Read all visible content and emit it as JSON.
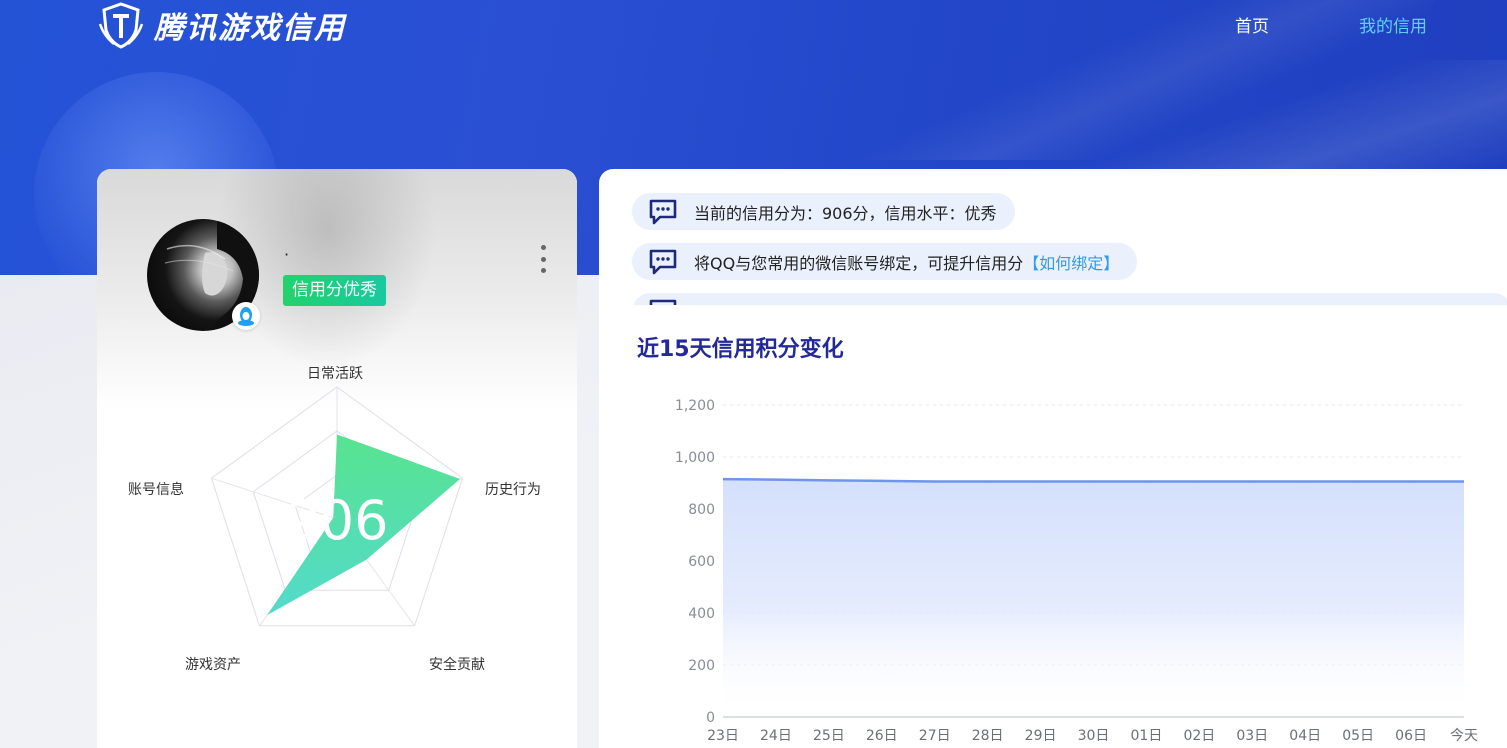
{
  "app": {
    "logo_text": "腾讯游戏信用",
    "logo_icon": "shield-logo-icon"
  },
  "nav": {
    "items": [
      {
        "label": "首页",
        "active": false
      },
      {
        "label": "我的信用",
        "active": true
      }
    ]
  },
  "profile": {
    "username": "·",
    "score_badge": "信用分优秀",
    "login_icon": "qq-penguin-icon",
    "score": "906",
    "radar": {
      "axes": [
        "日常活跃",
        "历史行为",
        "安全贡献",
        "游戏资产",
        "账号信息"
      ],
      "values": [
        0.64,
        0.98,
        0.38,
        0.9,
        0.0
      ]
    }
  },
  "messages": [
    {
      "prefix": "当前的信用分为：906分，信用水平：优秀",
      "link": ""
    },
    {
      "prefix": "将QQ与您常用的微信账号绑定，可提升信用分",
      "link": "【如何绑定】"
    }
  ],
  "colors": {
    "accent": "#23299a",
    "badge_green": "#23d26b",
    "nav_active": "#5ed0ff",
    "link": "#2f9bf0",
    "line": "#6f95ee"
  },
  "chart_data": {
    "type": "area",
    "title": "近15天信用积分变化",
    "categories": [
      "23日",
      "24日",
      "25日",
      "26日",
      "27日",
      "28日",
      "29日",
      "30日",
      "01日",
      "02日",
      "03日",
      "04日",
      "05日",
      "06日",
      "今天"
    ],
    "series": [
      {
        "values": [
          915,
          913,
          910,
          908,
          906,
          906,
          906,
          906,
          906,
          906,
          906,
          906,
          906,
          906,
          906
        ]
      }
    ],
    "yticks": [
      "0",
      "200",
      "400",
      "600",
      "800",
      "1,000",
      "1,200"
    ],
    "ylim": [
      0,
      1200
    ],
    "grid": true
  }
}
